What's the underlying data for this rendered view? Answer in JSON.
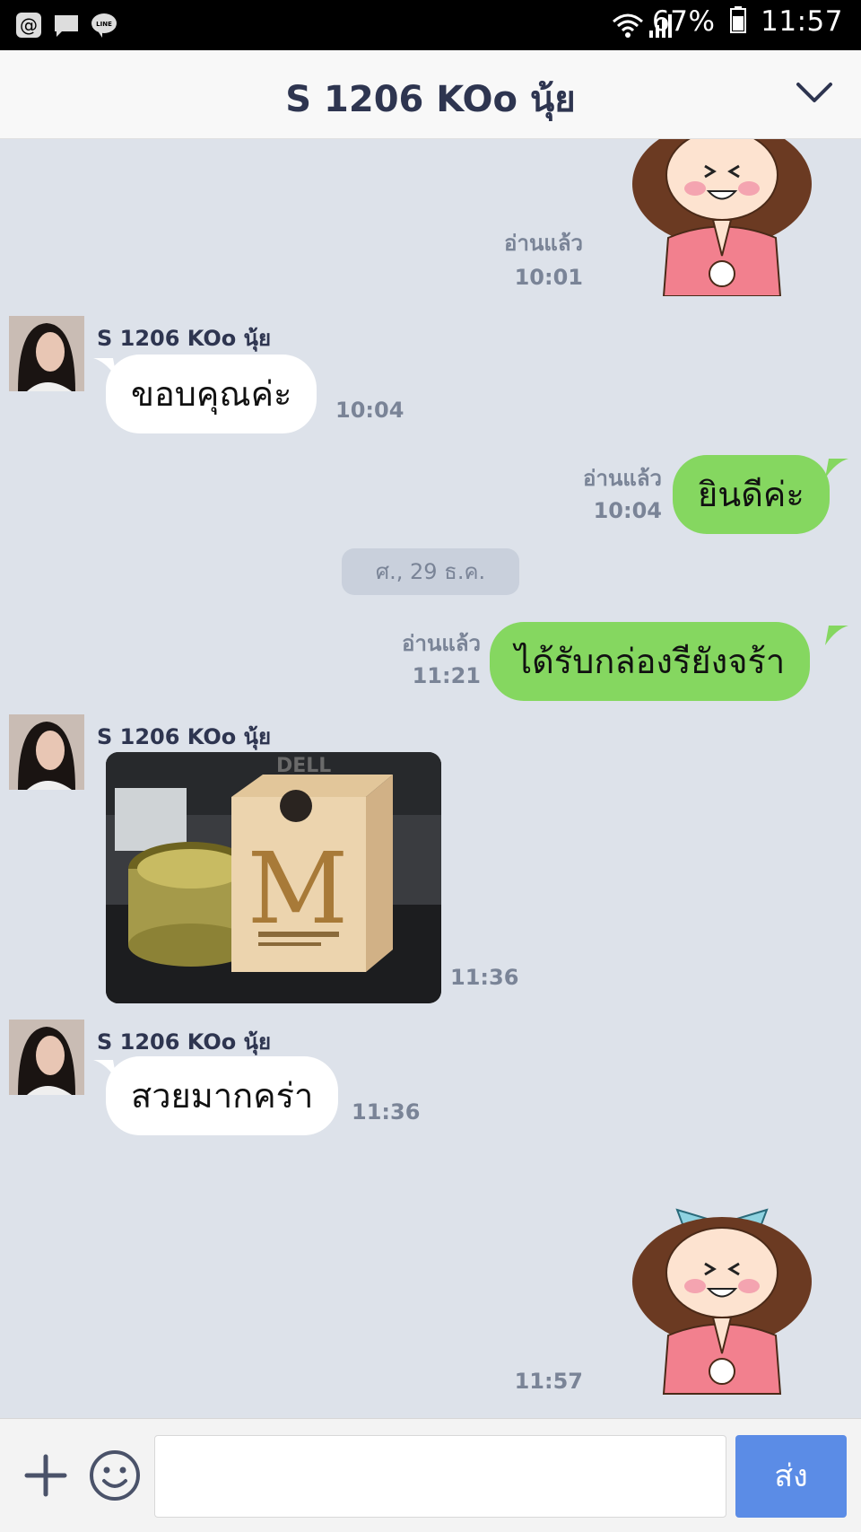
{
  "status_bar": {
    "battery": "67%",
    "time": "11:57",
    "icons": [
      "at-sign-icon",
      "message-icon",
      "line-app-icon",
      "wifi-icon",
      "signal-icon",
      "battery-icon"
    ]
  },
  "header": {
    "title": "S 1206 KOo นุ้ย"
  },
  "chat": {
    "sticker1": {
      "read": "อ่านแล้ว",
      "time": "10:01"
    },
    "msg1": {
      "sender": "S 1206 KOo นุ้ย",
      "text": "ขอบคุณค่ะ",
      "time": "10:04"
    },
    "msg2": {
      "read": "อ่านแล้ว",
      "time": "10:04",
      "text": "ยินดีค่ะ"
    },
    "date_separator": "ศ., 29 ธ.ค.",
    "msg3": {
      "read": "อ่านแล้ว",
      "time": "11:21",
      "text": "ได้รับกล่องรียังจร้า"
    },
    "photo_msg": {
      "sender": "S 1206 KOo นุ้ย",
      "time": "11:36",
      "box_letter": "M",
      "monitor_brand": "DELL"
    },
    "msg4": {
      "sender": "S 1206 KOo นุ้ย",
      "text": "สวยมากคร่า",
      "time": "11:36"
    },
    "sticker2": {
      "time": "11:57"
    }
  },
  "input_bar": {
    "placeholder": "",
    "send_label": "ส่ง"
  },
  "colors": {
    "background": "#dde2ea",
    "outgoing_bubble": "#85d760",
    "send_button": "#5b8ce6",
    "header_text": "#2e3550"
  }
}
